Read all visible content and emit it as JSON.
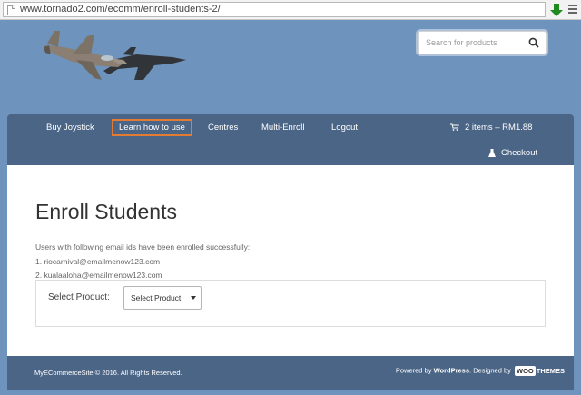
{
  "browser": {
    "url": "www.tornado2.com/ecomm/enroll-students-2/"
  },
  "header": {
    "search_placeholder": "Search for products"
  },
  "nav": {
    "items": [
      {
        "label": "Buy Joystick"
      },
      {
        "label": "Learn how to use"
      },
      {
        "label": "Centres"
      },
      {
        "label": "Multi-Enroll"
      },
      {
        "label": "Logout"
      }
    ],
    "cart": "2 items – RM1.88",
    "checkout": "Checkout"
  },
  "main": {
    "title": "Enroll Students",
    "message": "Users with following email ids have been enrolled successfully:",
    "emails": [
      "1. riocarnival@emailmenow123.com",
      "2. kualaaloha@emailmenow123.com"
    ],
    "product_label": "Select Product:",
    "product_select_value": "Select Product"
  },
  "footer": {
    "copyright": "MyECommerceSite © 2016. All Rights Reserved.",
    "powered_prefix": "Powered by ",
    "powered_wp": "WordPress",
    "designed_by": ". Designed by ",
    "woo": "WOO",
    "themes": "THEMES"
  },
  "colors": {
    "background": "#6e93bc",
    "nav": "#4b6586",
    "highlight": "#e47b33"
  }
}
